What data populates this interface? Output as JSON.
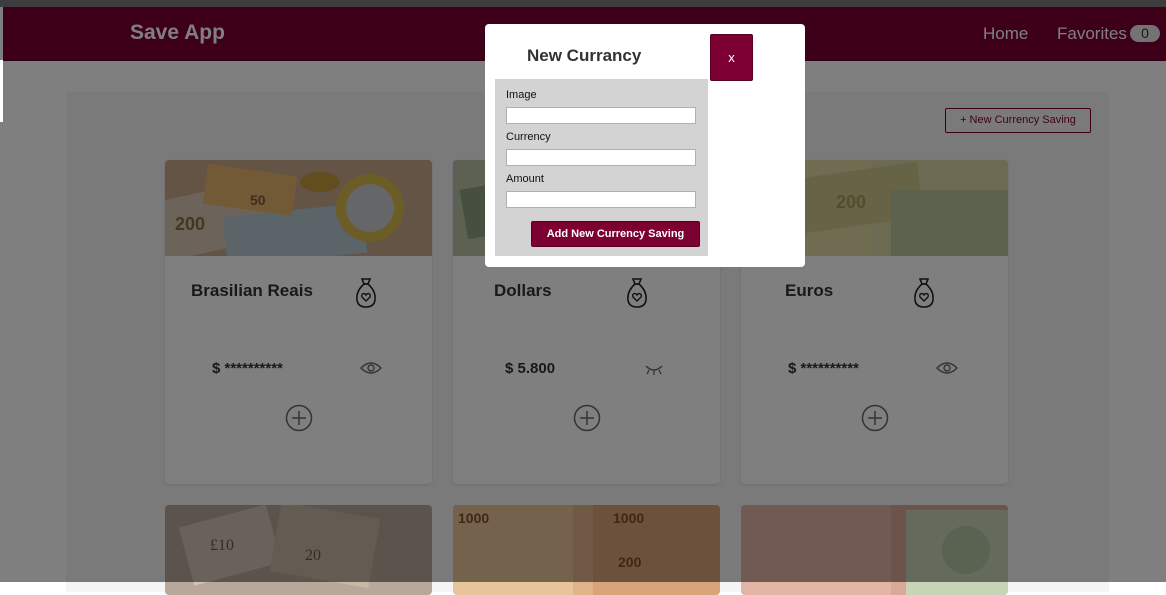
{
  "navbar": {
    "brand": "Save App",
    "home_label": "Home",
    "favorites_label": "Favorites",
    "favorites_count": "0"
  },
  "main": {
    "new_saving_button": "+ New Currency Saving",
    "cards": [
      {
        "title": "Brasilian Reais",
        "amount": "$ **********",
        "icon": "money-bag-icon",
        "visibility_icon": "eye-icon"
      },
      {
        "title": "Dollars",
        "amount": "$ 5.800",
        "icon": "money-bag-icon",
        "visibility_icon": "eye-closed-icon"
      },
      {
        "title": "Euros",
        "amount": "$ **********",
        "icon": "money-bag-icon",
        "visibility_icon": "eye-icon"
      }
    ]
  },
  "modal": {
    "title": "New Currancy",
    "close_label": "x",
    "fields": [
      {
        "label": "Image",
        "value": ""
      },
      {
        "label": "Currency",
        "value": ""
      },
      {
        "label": "Amount",
        "value": ""
      }
    ],
    "submit_label": "Add New Currency Saving"
  },
  "colors": {
    "brand": "#7d0033",
    "overlay": "rgba(0,0,0,0.5)",
    "panel": "#d3d3d3",
    "badge": "#e6e6e6"
  }
}
